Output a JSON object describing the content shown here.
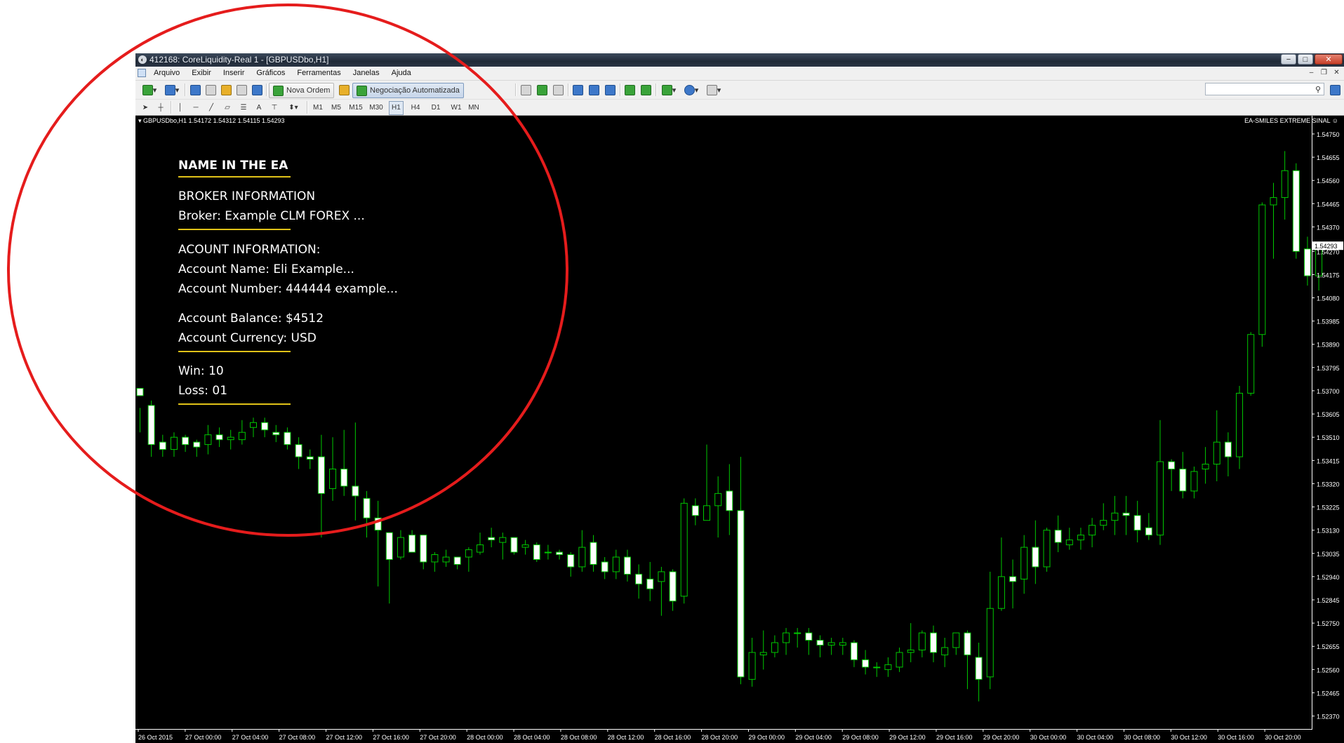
{
  "window": {
    "title": "412168: CoreLiquidity-Real 1 - [GBPUSDbo,H1]",
    "app_icon": "metatrader-icon",
    "controls": [
      "−",
      "□",
      "✕"
    ]
  },
  "menu": {
    "items": [
      "Arquivo",
      "Exibir",
      "Inserir",
      "Gráficos",
      "Ferramentas",
      "Janelas",
      "Ajuda"
    ],
    "mdi_controls": [
      "–",
      "❐",
      "✕"
    ]
  },
  "toolbar": {
    "nova_ordem": "Nova Ordem",
    "negociacao": "Negociação Automatizada",
    "search_placeholder": ""
  },
  "drawing_toolbar": {
    "text_tool": "A",
    "periods": [
      "M1",
      "M5",
      "M15",
      "M30",
      "H1",
      "H4",
      "D1",
      "W1",
      "MN"
    ],
    "active_period": "H1"
  },
  "chart": {
    "info": "GBPUSDbo,H1  1.54172 1.54312 1.54115 1.54293",
    "ea_label": "EA-SMILES EXTREME SINAL ☺",
    "current_price": "1.54293",
    "colors": {
      "background": "#000000",
      "bull": "#00c800",
      "bear_body": "#ffffff",
      "wick": "#00c800",
      "axis": "#ffffff",
      "circle": "#e51c1c",
      "rule": "#e0c218"
    }
  },
  "ea_panel": {
    "title": "NAME IN THE EA",
    "broker_heading": "BROKER INFORMATION",
    "broker_line": "Broker:  Example CLM FOREX ...",
    "account_heading": "ACOUNT INFORMATION:",
    "account_name": "Account Name:  Eli Example...",
    "account_number": "Account Number:  444444 example...",
    "account_balance": "Account Balance:  $4512",
    "account_currency": "Account Currency:  USD",
    "win": "Win: 10",
    "loss": "Loss: 01"
  },
  "chart_data": {
    "type": "candlestick",
    "title": "",
    "symbol": "GBPUSDbo",
    "timeframe": "H1",
    "y_ticks": [
      "1.54750",
      "1.54655",
      "1.54560",
      "1.54465",
      "1.54370",
      "1.54270",
      "1.54175",
      "1.54080",
      "1.53985",
      "1.53890",
      "1.53795",
      "1.53700",
      "1.53605",
      "1.53510",
      "1.53415",
      "1.53320",
      "1.53225",
      "1.53130",
      "1.53035",
      "1.52940",
      "1.52845",
      "1.52750",
      "1.52655",
      "1.52560",
      "1.52465",
      "1.52370"
    ],
    "x_ticks": [
      "26 Oct 2015",
      "27 Oct 00:00",
      "27 Oct 04:00",
      "27 Oct 08:00",
      "27 Oct 12:00",
      "27 Oct 16:00",
      "27 Oct 20:00",
      "28 Oct 00:00",
      "28 Oct 04:00",
      "28 Oct 08:00",
      "28 Oct 12:00",
      "28 Oct 16:00",
      "28 Oct 20:00",
      "29 Oct 00:00",
      "29 Oct 04:00",
      "29 Oct 08:00",
      "29 Oct 12:00",
      "29 Oct 16:00",
      "29 Oct 20:00",
      "30 Oct 00:00",
      "30 Oct 04:00",
      "30 Oct 08:00",
      "30 Oct 12:00",
      "30 Oct 16:00",
      "30 Oct 20:00"
    ],
    "ylim": [
      1.5232,
      1.5479
    ],
    "candles": [
      [
        1.5371,
        1.5363,
        1.5368,
        1.5353
      ],
      [
        1.5364,
        1.5366,
        1.5348,
        1.5343
      ],
      [
        1.5349,
        1.5352,
        1.5346,
        1.5343
      ],
      [
        1.5346,
        1.5353,
        1.5351,
        1.5343
      ],
      [
        1.5351,
        1.5352,
        1.5348,
        1.5345
      ],
      [
        1.5349,
        1.535,
        1.5347,
        1.5343
      ],
      [
        1.5348,
        1.5356,
        1.5352,
        1.5344
      ],
      [
        1.5352,
        1.5355,
        1.535,
        1.5347
      ],
      [
        1.535,
        1.5354,
        1.5351,
        1.5346
      ],
      [
        1.535,
        1.5358,
        1.5353,
        1.5348
      ],
      [
        1.5355,
        1.5359,
        1.5357,
        1.5351
      ],
      [
        1.5357,
        1.5359,
        1.5354,
        1.5351
      ],
      [
        1.5353,
        1.5356,
        1.5352,
        1.5349
      ],
      [
        1.5353,
        1.5355,
        1.5348,
        1.5346
      ],
      [
        1.5348,
        1.5351,
        1.5343,
        1.5338
      ],
      [
        1.5343,
        1.5346,
        1.5342,
        1.5338
      ],
      [
        1.5343,
        1.5352,
        1.5328,
        1.531
      ],
      [
        1.533,
        1.5351,
        1.5338,
        1.5325
      ],
      [
        1.5338,
        1.5354,
        1.5331,
        1.5327
      ],
      [
        1.5331,
        1.5357,
        1.5327,
        1.5317
      ],
      [
        1.5326,
        1.5329,
        1.5318,
        1.531
      ],
      [
        1.5318,
        1.5325,
        1.5313,
        1.529
      ],
      [
        1.5312,
        1.5306,
        1.5301,
        1.5283
      ],
      [
        1.5302,
        1.5313,
        1.531,
        1.5301
      ],
      [
        1.5311,
        1.5313,
        1.5304,
        1.5304
      ],
      [
        1.5311,
        1.5303,
        1.53,
        1.5297
      ],
      [
        1.53,
        1.5304,
        1.5303,
        1.5296
      ],
      [
        1.53,
        1.5305,
        1.5302,
        1.5298
      ],
      [
        1.5302,
        1.5302,
        1.5299,
        1.5297
      ],
      [
        1.5302,
        1.5306,
        1.5305,
        1.5296
      ],
      [
        1.5304,
        1.5312,
        1.5307,
        1.5303
      ],
      [
        1.531,
        1.5314,
        1.5309,
        1.5306
      ],
      [
        1.5308,
        1.5312,
        1.531,
        1.5301
      ],
      [
        1.531,
        1.5308,
        1.5304,
        1.5303
      ],
      [
        1.5306,
        1.5309,
        1.5307,
        1.5303
      ],
      [
        1.5307,
        1.5308,
        1.5301,
        1.53
      ],
      [
        1.5304,
        1.5307,
        1.5304,
        1.5301
      ],
      [
        1.5304,
        1.5305,
        1.5303,
        1.5301
      ],
      [
        1.5303,
        1.5304,
        1.5298,
        1.5294
      ],
      [
        1.5298,
        1.5313,
        1.5306,
        1.5296
      ],
      [
        1.5308,
        1.5311,
        1.5299,
        1.5296
      ],
      [
        1.53,
        1.5302,
        1.5296,
        1.5293
      ],
      [
        1.5296,
        1.5305,
        1.5302,
        1.5293
      ],
      [
        1.5302,
        1.5305,
        1.5295,
        1.5292
      ],
      [
        1.5295,
        1.5299,
        1.5291,
        1.5285
      ],
      [
        1.5293,
        1.53,
        1.5289,
        1.5284
      ],
      [
        1.5292,
        1.5298,
        1.5296,
        1.5278
      ],
      [
        1.5296,
        1.5297,
        1.5284,
        1.528
      ],
      [
        1.5286,
        1.5326,
        1.5324,
        1.5283
      ],
      [
        1.5323,
        1.5326,
        1.5319,
        1.5315
      ],
      [
        1.5317,
        1.5348,
        1.5323,
        1.532
      ],
      [
        1.5323,
        1.5335,
        1.5328,
        1.531
      ],
      [
        1.5329,
        1.534,
        1.5321,
        1.5311
      ],
      [
        1.5321,
        1.5343,
        1.5253,
        1.525
      ],
      [
        1.5252,
        1.5269,
        1.5263,
        1.5249
      ],
      [
        1.5262,
        1.5272,
        1.5263,
        1.5256
      ],
      [
        1.5263,
        1.527,
        1.5267,
        1.5261
      ],
      [
        1.5267,
        1.5273,
        1.5271,
        1.5262
      ],
      [
        1.5271,
        1.5273,
        1.5271,
        1.5265
      ],
      [
        1.5271,
        1.5273,
        1.5268,
        1.5262
      ],
      [
        1.5268,
        1.527,
        1.5266,
        1.5261
      ],
      [
        1.5266,
        1.5269,
        1.5267,
        1.5262
      ],
      [
        1.5266,
        1.5269,
        1.5267,
        1.5262
      ],
      [
        1.5267,
        1.5268,
        1.526,
        1.5257
      ],
      [
        1.526,
        1.5264,
        1.5257,
        1.5254
      ],
      [
        1.5257,
        1.5259,
        1.5257,
        1.5253
      ],
      [
        1.5256,
        1.5261,
        1.5258,
        1.5253
      ],
      [
        1.5257,
        1.5265,
        1.5263,
        1.5255
      ],
      [
        1.5263,
        1.5275,
        1.5264,
        1.5259
      ],
      [
        1.5264,
        1.5272,
        1.5271,
        1.5261
      ],
      [
        1.5271,
        1.5274,
        1.5263,
        1.5259
      ],
      [
        1.5262,
        1.5269,
        1.5265,
        1.5257
      ],
      [
        1.5265,
        1.5271,
        1.5271,
        1.5262
      ],
      [
        1.5271,
        1.5272,
        1.5262,
        1.5248
      ],
      [
        1.5261,
        1.5267,
        1.5252,
        1.5243
      ],
      [
        1.5253,
        1.5296,
        1.5281,
        1.5248
      ],
      [
        1.5281,
        1.531,
        1.5294,
        1.528
      ],
      [
        1.5294,
        1.5301,
        1.5292,
        1.5281
      ],
      [
        1.5293,
        1.5311,
        1.5306,
        1.5287
      ],
      [
        1.5306,
        1.5317,
        1.5298,
        1.5291
      ],
      [
        1.5298,
        1.5314,
        1.5313,
        1.5296
      ],
      [
        1.5313,
        1.5319,
        1.5308,
        1.5304
      ],
      [
        1.5307,
        1.5314,
        1.5309,
        1.5305
      ],
      [
        1.5309,
        1.5314,
        1.5311,
        1.5305
      ],
      [
        1.5311,
        1.5318,
        1.5315,
        1.5306
      ],
      [
        1.5315,
        1.5324,
        1.5317,
        1.5313
      ],
      [
        1.5317,
        1.5327,
        1.532,
        1.5311
      ],
      [
        1.532,
        1.5327,
        1.5319,
        1.5311
      ],
      [
        1.5319,
        1.5325,
        1.5313,
        1.5308
      ],
      [
        1.5314,
        1.532,
        1.5311,
        1.5309
      ],
      [
        1.5311,
        1.5358,
        1.5341,
        1.5307
      ],
      [
        1.5341,
        1.5342,
        1.5338,
        1.5329
      ],
      [
        1.5338,
        1.5345,
        1.5329,
        1.5326
      ],
      [
        1.5329,
        1.5339,
        1.5337,
        1.5326
      ],
      [
        1.5338,
        1.5347,
        1.534,
        1.5332
      ],
      [
        1.534,
        1.5362,
        1.5349,
        1.5333
      ],
      [
        1.5349,
        1.5353,
        1.5343,
        1.5335
      ],
      [
        1.5343,
        1.5372,
        1.5369,
        1.5338
      ],
      [
        1.5369,
        1.5394,
        1.5393,
        1.5368
      ],
      [
        1.5393,
        1.5447,
        1.5446,
        1.5388
      ],
      [
        1.5446,
        1.5455,
        1.5449,
        1.5424
      ],
      [
        1.5449,
        1.5468,
        1.546,
        1.544
      ],
      [
        1.546,
        1.5463,
        1.5427,
        1.5424
      ],
      [
        1.5428,
        1.5433,
        1.5417,
        1.5413
      ],
      [
        1.5417,
        1.5431,
        1.5429,
        1.5411
      ]
    ]
  }
}
